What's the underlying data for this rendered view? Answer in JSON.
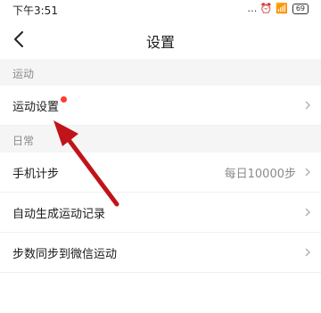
{
  "status_bar": {
    "time": "下午3:51",
    "signal": "… ⏰ 📶 ",
    "battery": "69"
  },
  "header": {
    "title": "设置"
  },
  "sections": [
    {
      "label": "运动",
      "rows": [
        {
          "label": "运动设置",
          "has_dot": true,
          "value": ""
        }
      ]
    },
    {
      "label": "日常",
      "rows": [
        {
          "label": "手机计步",
          "value": "每日10000步"
        },
        {
          "label": "自动生成运动记录",
          "value": ""
        },
        {
          "label": "步数同步到微信运动",
          "value": ""
        }
      ]
    }
  ],
  "accent_red": "#ff3b30",
  "annotation_arrow_color": "#c0141a"
}
